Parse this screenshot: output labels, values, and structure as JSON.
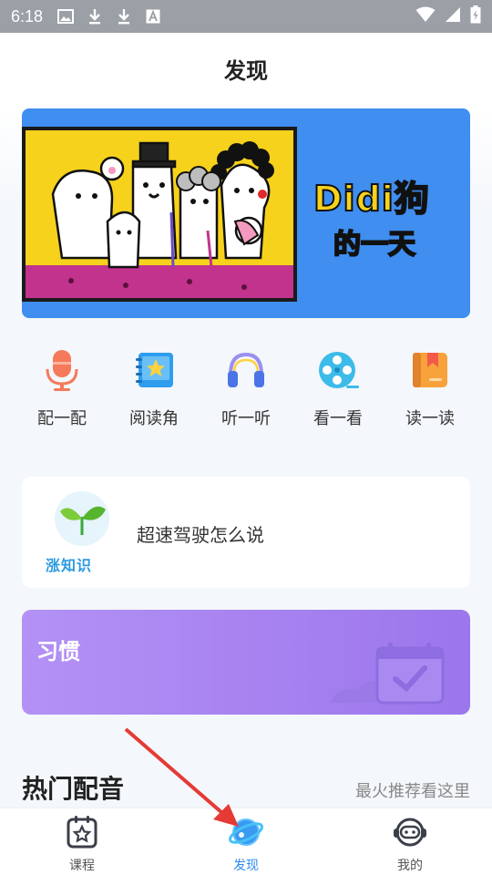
{
  "status_bar": {
    "time": "6:18",
    "icons": [
      "image-icon",
      "download-icon",
      "download-icon",
      "font-icon",
      "wifi-icon",
      "signal-icon",
      "battery-icon"
    ]
  },
  "header": {
    "title": "发现"
  },
  "banner": {
    "title_main": "Didi狗",
    "title_sub": "的一天",
    "colors": {
      "background": "#3f8ef0",
      "title": "#f7d21c",
      "stage": "#c2338d"
    }
  },
  "shortcuts": [
    {
      "label": "配一配",
      "icon": "microphone-icon"
    },
    {
      "label": "阅读角",
      "icon": "star-book-icon"
    },
    {
      "label": "听一听",
      "icon": "headphones-icon"
    },
    {
      "label": "看一看",
      "icon": "film-reel-icon"
    },
    {
      "label": "读一读",
      "icon": "book-icon"
    }
  ],
  "knowledge_card": {
    "logo_text": "涨知识",
    "title": "超速驾驶怎么说"
  },
  "habit_card": {
    "title": "习惯"
  },
  "hot_section": {
    "title": "热门配音",
    "more": "最火推荐看这里"
  },
  "bottom_nav": {
    "items": [
      {
        "label": "课程",
        "icon": "calendar-star-icon",
        "active": false
      },
      {
        "label": "发现",
        "icon": "planet-icon",
        "active": true
      },
      {
        "label": "我的",
        "icon": "robot-face-icon",
        "active": false
      }
    ],
    "active_color": "#2d8cf0"
  }
}
